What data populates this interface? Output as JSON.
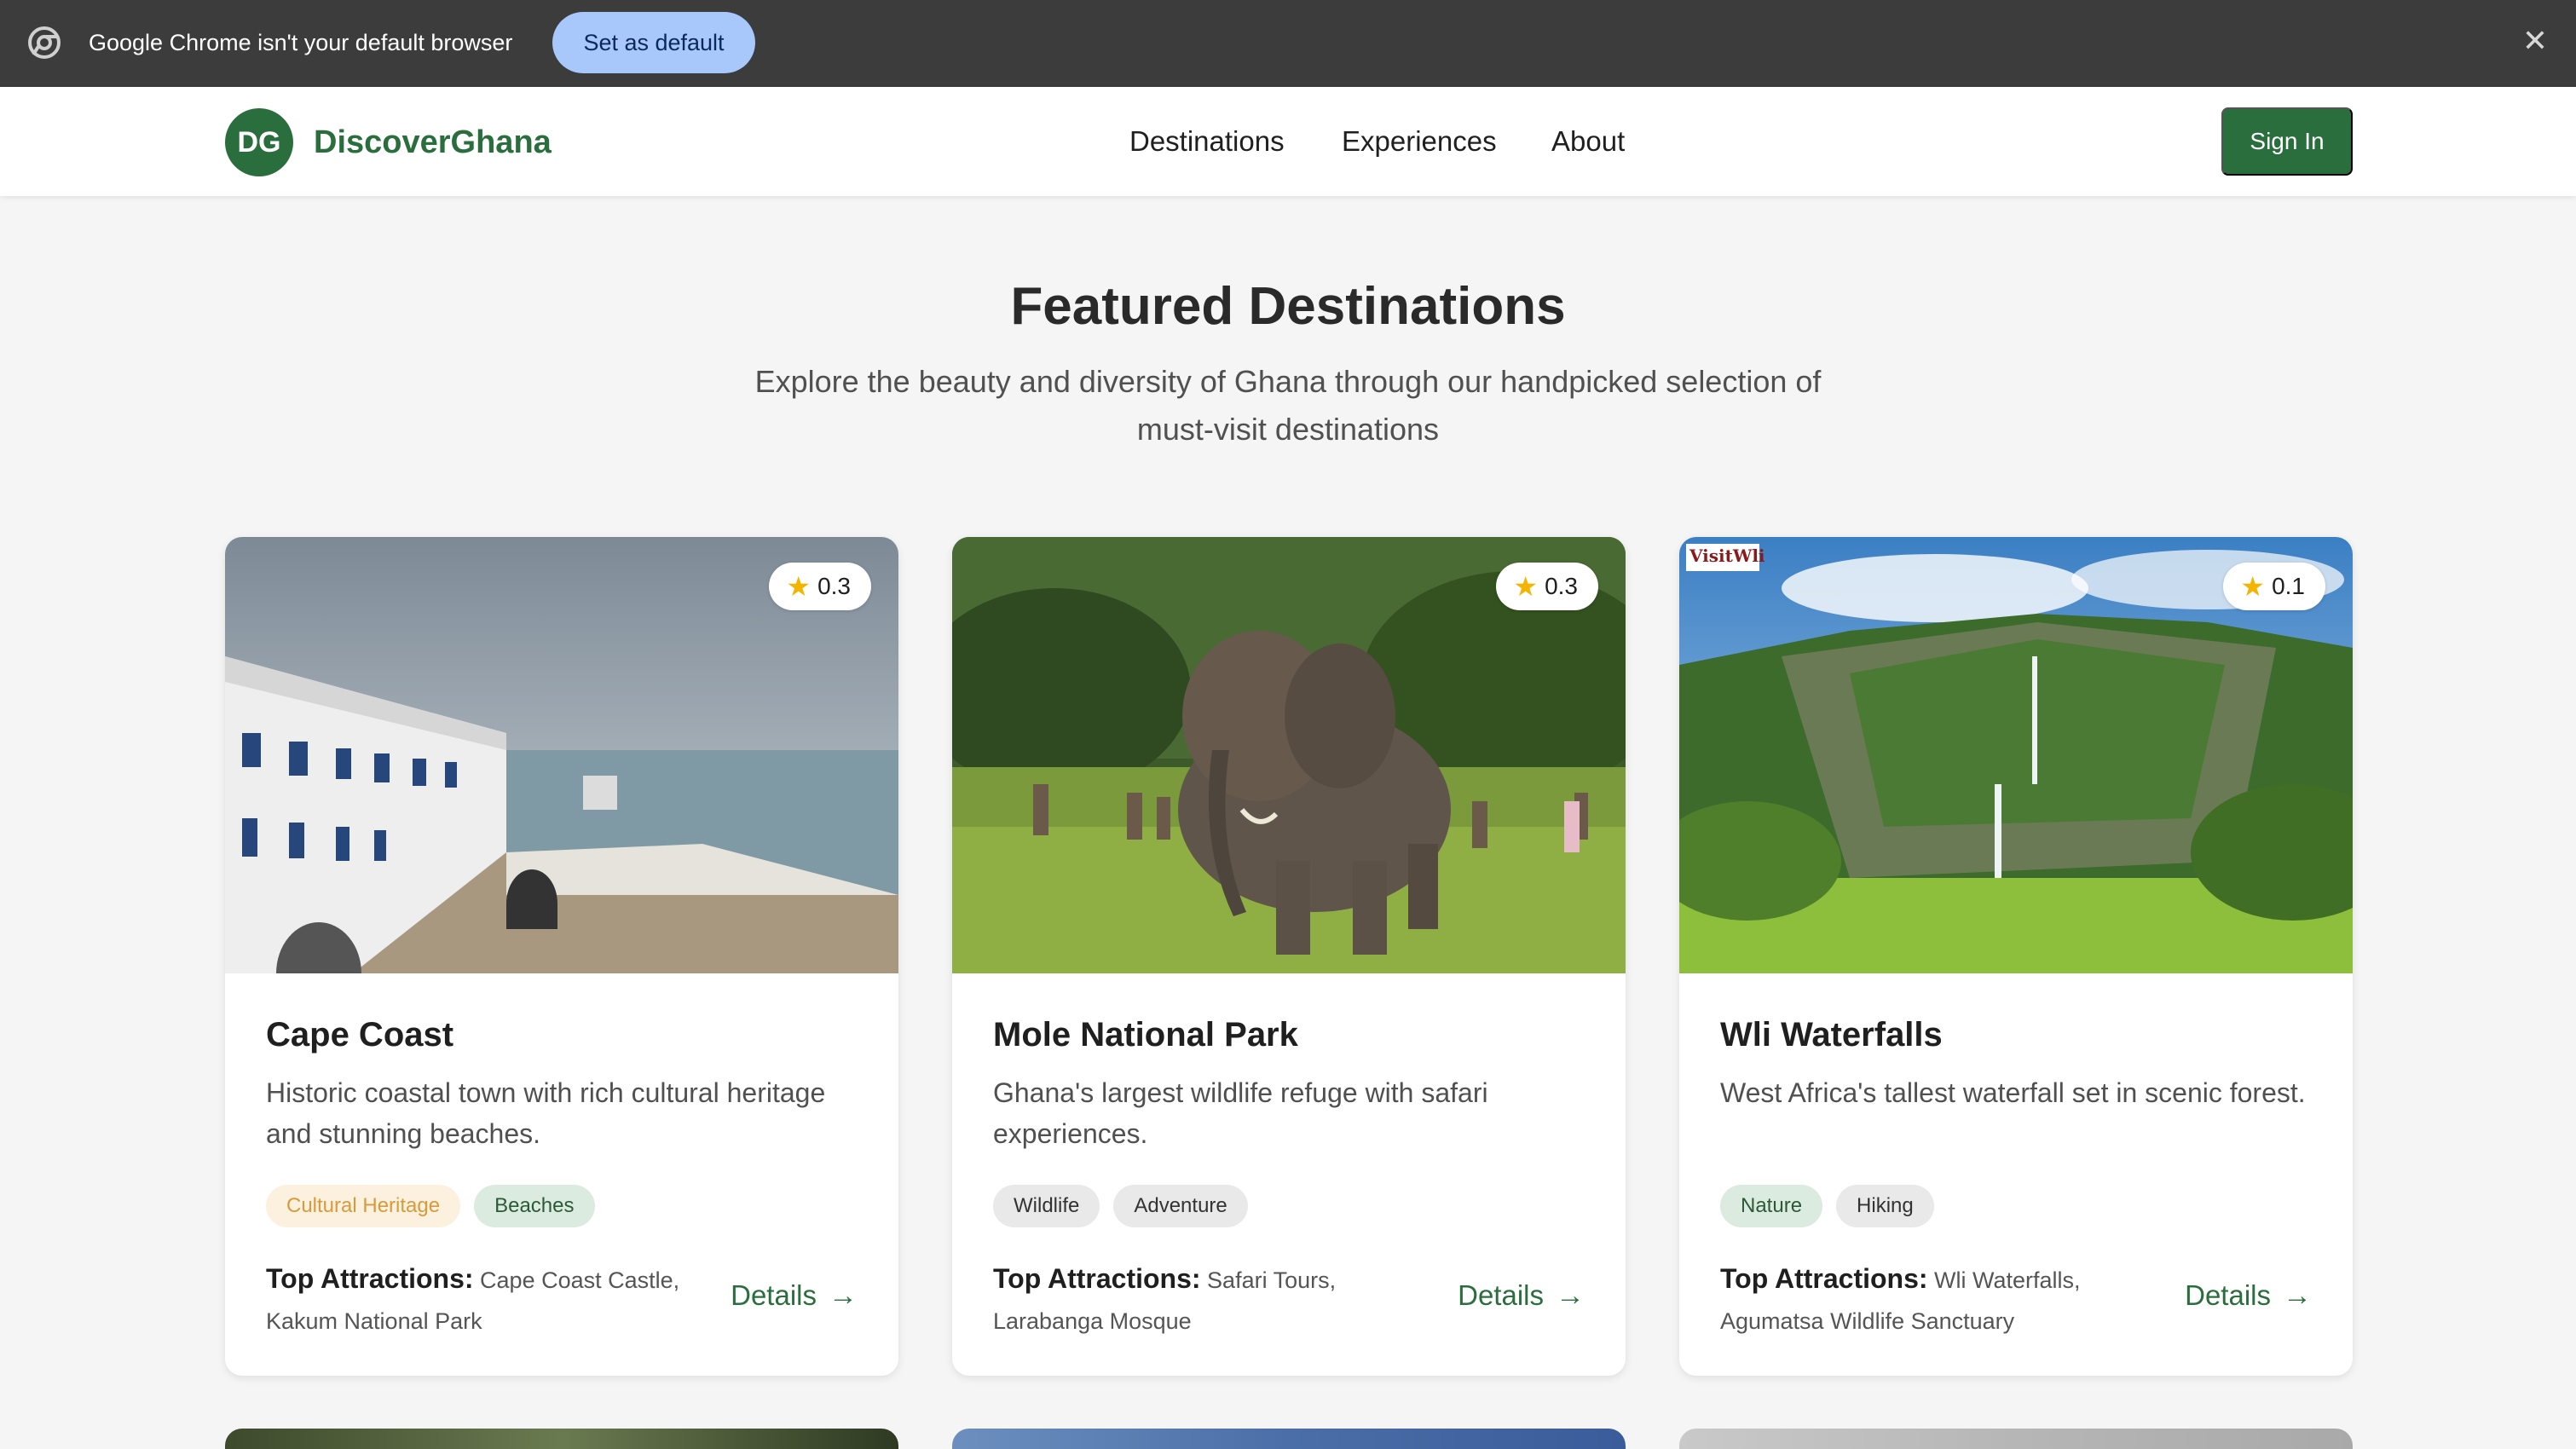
{
  "infobar": {
    "message": "Google Chrome isn't your default browser",
    "set_default_label": "Set as default",
    "close_icon": "close-icon"
  },
  "header": {
    "logo_text": "DG",
    "brand": "DiscoverGhana",
    "nav": [
      "Destinations",
      "Experiences",
      "About"
    ],
    "sign_in": "Sign In"
  },
  "hero": {
    "title": "Featured Destinations",
    "subtitle": "Explore the beauty and diversity of Ghana through our handpicked selection of must-visit destinations"
  },
  "cards": [
    {
      "title": "Cape Coast",
      "rating": "0.3",
      "description": "Historic coastal town with rich cultural heritage and stunning beaches.",
      "tags": [
        "Cultural Heritage",
        "Beaches"
      ],
      "attractions_label": "Top Attractions:",
      "attractions": "Cape Coast Castle, Kakum National Park",
      "details_label": "Details"
    },
    {
      "title": "Mole National Park",
      "rating": "0.3",
      "description": "Ghana's largest wildlife refuge with safari experiences.",
      "tags": [
        "Wildlife",
        "Adventure"
      ],
      "attractions_label": "Top Attractions:",
      "attractions": "Safari Tours, Larabanga Mosque",
      "details_label": "Details"
    },
    {
      "title": "Wli Waterfalls",
      "rating": "0.1",
      "description": "West Africa's tallest waterfall set in scenic forest.",
      "tags": [
        "Nature",
        "Hiking"
      ],
      "attractions_label": "Top Attractions:",
      "attractions": "Wli Waterfalls, Agumatsa Wildlife Sanctuary",
      "details_label": "Details"
    }
  ],
  "colors": {
    "brand_green": "#2b6e3e",
    "infobar_bg": "#3c3c3c",
    "set_default_bg": "#a8c7fa",
    "star": "#f5b400",
    "tag_heritage_bg": "#fcf1de",
    "tag_heritage_fg": "#d89a3a",
    "tag_green_bg": "#dcebdf",
    "tag_green_fg": "#2b5a37",
    "tag_gray_bg": "#e9e9e9",
    "tag_gray_fg": "#333333"
  },
  "card3_image_logo": "VisitWli"
}
